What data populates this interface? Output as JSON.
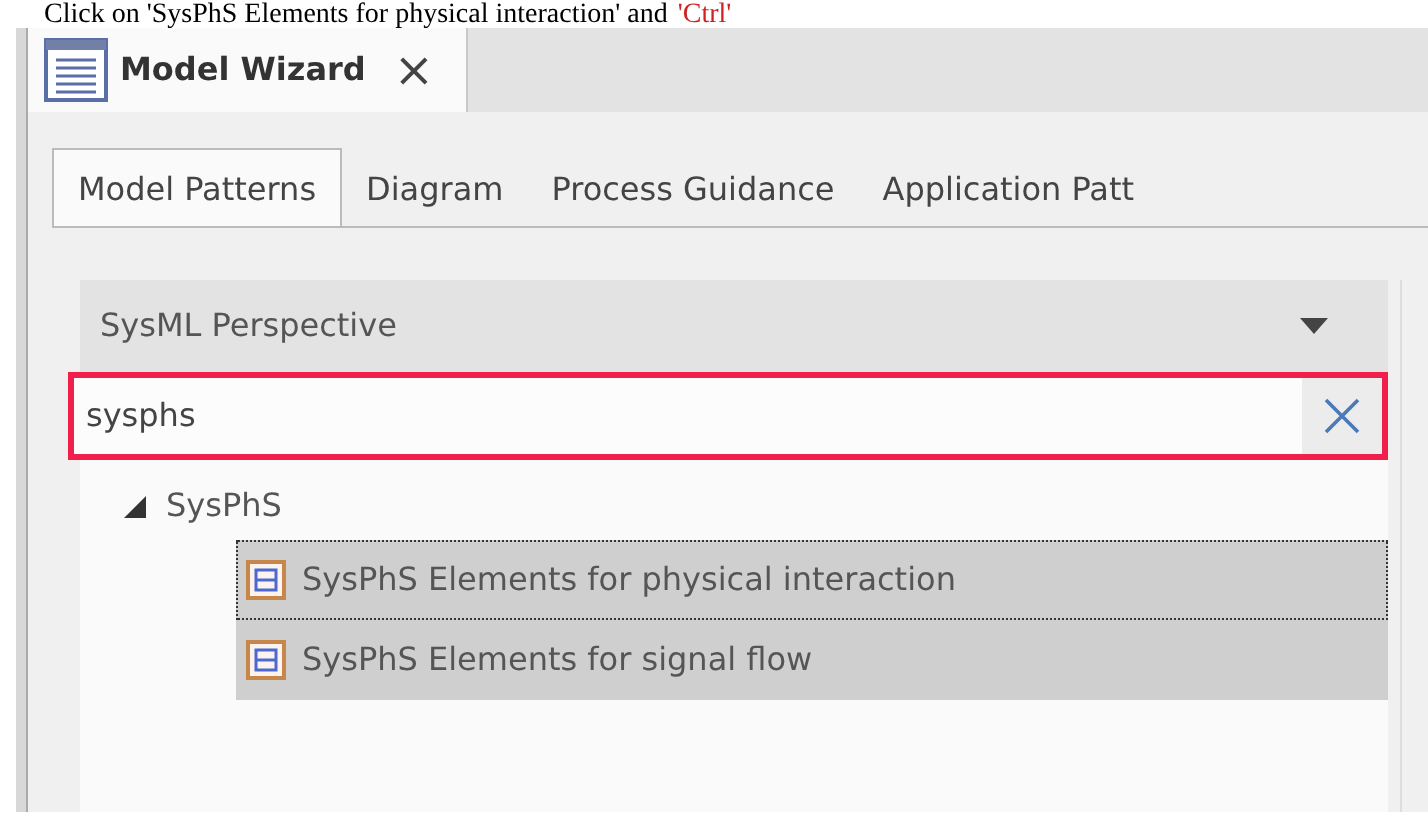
{
  "caption": {
    "text": "Click on 'SysPhS Elements for physical interaction' and",
    "highlight": "'Ctrl'"
  },
  "window": {
    "title": "Model Wizard",
    "close": "×"
  },
  "tabs": [
    {
      "label": "Model Patterns",
      "selected": true
    },
    {
      "label": "Diagram",
      "selected": false
    },
    {
      "label": "Process Guidance",
      "selected": false
    },
    {
      "label": "Application Patt",
      "selected": false
    }
  ],
  "perspective": {
    "value": "SysML Perspective"
  },
  "search": {
    "value": "sysphs",
    "highlighted": true
  },
  "tree": [
    {
      "label": "SysPhS",
      "expanded": true,
      "children": [
        {
          "label": "SysPhS Elements for physical interaction",
          "selected": true,
          "focused": true
        },
        {
          "label": "SysPhS Elements for signal flow",
          "selected": true,
          "focused": false
        }
      ]
    }
  ]
}
